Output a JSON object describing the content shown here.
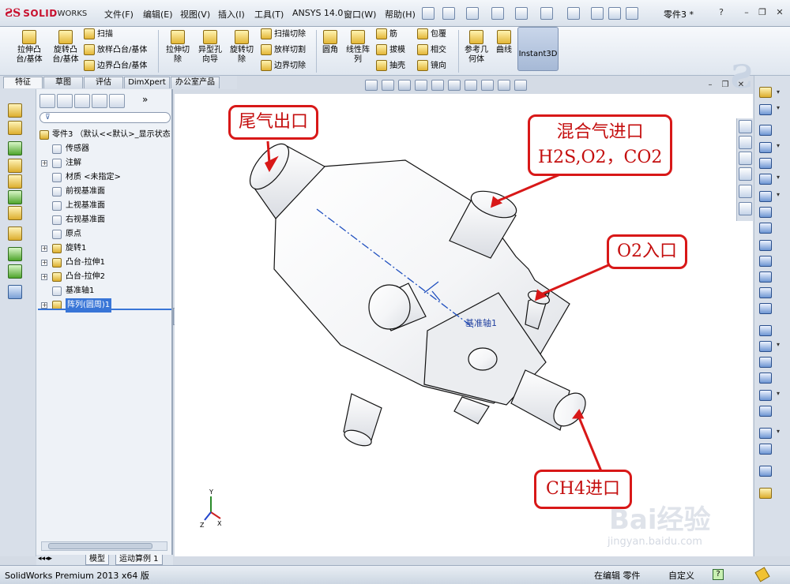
{
  "app": {
    "logo_prefix": "ƧS",
    "logo_brand": "SOLID",
    "logo_suffix": "WORKS",
    "document_title": "零件3 *",
    "menu": [
      "文件(F)",
      "编辑(E)",
      "视图(V)",
      "插入(I)",
      "工具(T)",
      "ANSYS 14.0",
      "窗口(W)",
      "帮助(H)"
    ]
  },
  "ribbon": {
    "big_buttons": [
      "拉伸凸\n台/基体",
      "旋转凸\n台/基体",
      "拉伸切\n除",
      "异型孔\n向导",
      "旋转切\n除",
      "圆角",
      "线性阵\n列",
      "参考几\n何体",
      "曲线"
    ],
    "small_buttons": [
      "扫描",
      "放样凸台/基体",
      "边界凸台/基体",
      "扫描切除",
      "放样切割",
      "边界切除",
      "筋",
      "拔模",
      "抽壳",
      "包覆",
      "相交",
      "镜向"
    ],
    "instant3d": "Instant3D"
  },
  "command_tabs": [
    "特征",
    "草图",
    "评估",
    "DimXpert",
    "办公室产品"
  ],
  "feature_tree": {
    "filter_icon": "funnel-icon",
    "root": "零件3 （默认<<默认>_显示状态",
    "items": [
      "传感器",
      "注解",
      "材质 <未指定>",
      "前视基准面",
      "上视基准面",
      "右视基准面",
      "原点",
      "旋转1",
      "凸台-拉伸1",
      "凸台-拉伸2",
      "基准轴1",
      "阵列(圆周)1"
    ],
    "selected": "阵列(圆周)1",
    "collapse_label": "»"
  },
  "viewport": {
    "callouts": {
      "exhaust": "尾气出口",
      "mixed_gas_line1": "混合气进口",
      "mixed_gas_line2": "H2S,O2，CO2",
      "o2": "O2入口",
      "ch4": "CH4进口"
    },
    "axis_label": "基准轴1",
    "triad": {
      "y": "Y",
      "x": "X",
      "z": "Z"
    },
    "watermark": "Bai经验",
    "watermark_url": "jingyan.baidu.com"
  },
  "bottom_tabs": [
    "模型",
    "运动算例 1"
  ],
  "status": {
    "product": "SolidWorks Premium 2013 x64 版",
    "mode": "在编辑 零件",
    "units": "自定义",
    "help": "?"
  },
  "colors": {
    "callout_red": "#d81818",
    "selection_blue": "#3875d7",
    "axis_blue": "#1f4fbf"
  }
}
